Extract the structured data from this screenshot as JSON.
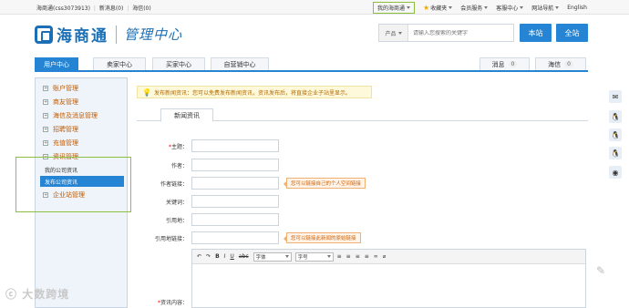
{
  "topbar": {
    "account": "海商通(css3073913)",
    "new_msg": "新消息(0)",
    "trade_msg": "海信(0)",
    "my_site": "我的海商通",
    "favorites": "收藏夹",
    "member_service": "会员服务",
    "customer_service": "客服中心",
    "site_nav": "网站导航",
    "english": "English"
  },
  "header": {
    "logo_name": "海商通",
    "logo_sub": "管理中心",
    "search_category": "产品",
    "search_placeholder": "请输入您搜索的关键字",
    "btn_site": "本站",
    "btn_all": "全站"
  },
  "nav": {
    "tabs": [
      {
        "label": "用户中心"
      },
      {
        "label": "卖家中心"
      },
      {
        "label": "买家中心"
      },
      {
        "label": "自营销中心"
      }
    ],
    "messages": "消息",
    "messages_count": "0",
    "trade": "海信",
    "trade_count": "0"
  },
  "sidebar": {
    "items": [
      {
        "label": "账户管理"
      },
      {
        "label": "商友管理"
      },
      {
        "label": "海信及消息管理"
      },
      {
        "label": "招聘管理"
      },
      {
        "label": "充值管理"
      },
      {
        "label": "资讯管理"
      },
      {
        "label": "企业站管理"
      }
    ],
    "sub_items": [
      {
        "label": "我的公司资讯"
      },
      {
        "label": "发布公司资讯"
      }
    ]
  },
  "main": {
    "tip": "发布新闻资讯：您可以免费发布新闻资讯，资讯发布后，将直接企业子站里显示。",
    "subtab": "新闻资讯",
    "fields": {
      "title": "主题：",
      "author": "作者：",
      "author_link": "作者链接：",
      "keywords": "关键词：",
      "source": "引用地：",
      "source_link": "引用地链接：",
      "content": "资讯内容："
    },
    "hint_author_link": "您可以链接自己的个人空间链接",
    "hint_source_link": "您可以链接此新闻的原始链接",
    "editor": {
      "font_label": "字体",
      "size_label": "字号"
    }
  },
  "watermark": "大数跨境",
  "colors": {
    "accent": "#2585d4",
    "highlight_box": "#8cbf3f",
    "sidebar_text": "#c25a00"
  }
}
